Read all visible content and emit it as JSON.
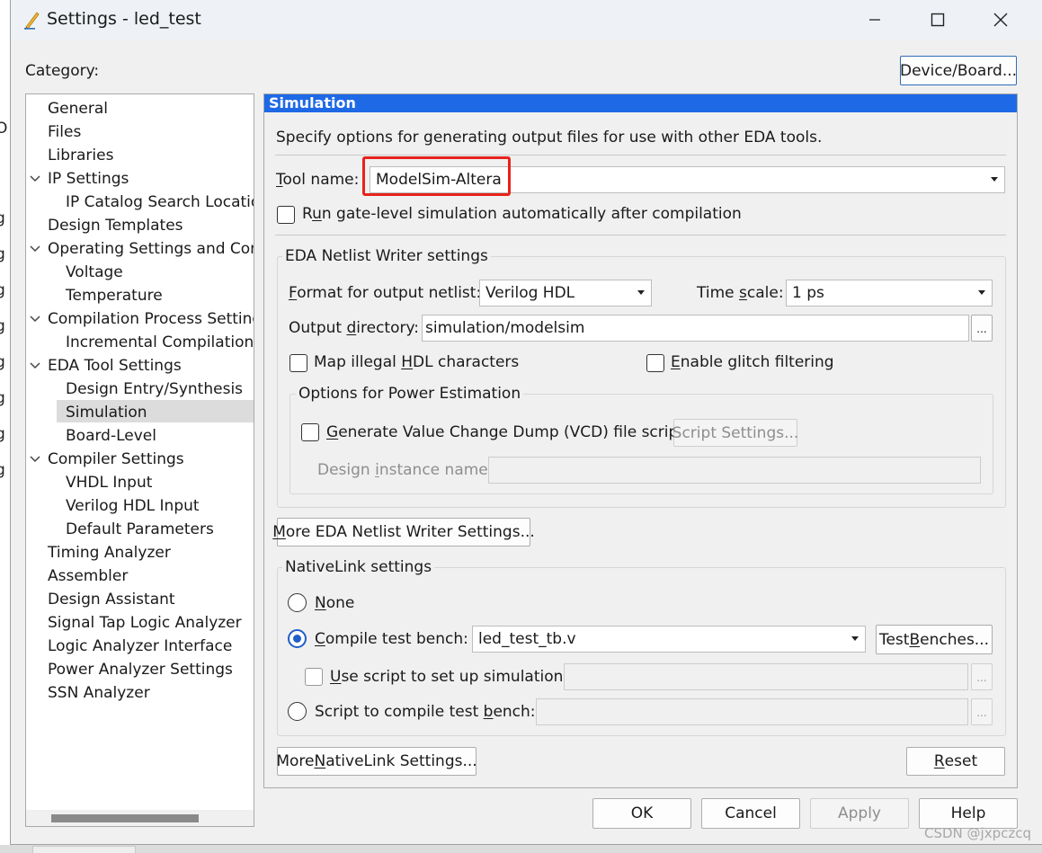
{
  "window": {
    "title": "Settings - led_test",
    "minimize_label": "—",
    "maximize_label": "☐",
    "close_label": "✕"
  },
  "left_strip_glyphs": [
    "O",
    "g",
    "g",
    "g",
    "g",
    "g",
    "g",
    "g",
    "g"
  ],
  "category_label": "Category:",
  "device_board_button": "Device/Board...",
  "tree": {
    "items": [
      {
        "label": "General",
        "level": 0,
        "expanded": null
      },
      {
        "label": "Files",
        "level": 0,
        "expanded": null
      },
      {
        "label": "Libraries",
        "level": 0,
        "expanded": null
      },
      {
        "label": "IP Settings",
        "level": 0,
        "expanded": true
      },
      {
        "label": "IP Catalog Search Locations",
        "level": 1,
        "expanded": null
      },
      {
        "label": "Design Templates",
        "level": 0,
        "expanded": null
      },
      {
        "label": "Operating Settings and Conditions",
        "level": 0,
        "expanded": true
      },
      {
        "label": "Voltage",
        "level": 1,
        "expanded": null
      },
      {
        "label": "Temperature",
        "level": 1,
        "expanded": null
      },
      {
        "label": "Compilation Process Settings",
        "level": 0,
        "expanded": true
      },
      {
        "label": "Incremental Compilation",
        "level": 1,
        "expanded": null
      },
      {
        "label": "EDA Tool Settings",
        "level": 0,
        "expanded": true
      },
      {
        "label": "Design Entry/Synthesis",
        "level": 1,
        "expanded": null
      },
      {
        "label": "Simulation",
        "level": 1,
        "expanded": null,
        "selected": true
      },
      {
        "label": "Board-Level",
        "level": 1,
        "expanded": null
      },
      {
        "label": "Compiler Settings",
        "level": 0,
        "expanded": true
      },
      {
        "label": "VHDL Input",
        "level": 1,
        "expanded": null
      },
      {
        "label": "Verilog HDL Input",
        "level": 1,
        "expanded": null
      },
      {
        "label": "Default Parameters",
        "level": 1,
        "expanded": null
      },
      {
        "label": "Timing Analyzer",
        "level": 0,
        "expanded": null
      },
      {
        "label": "Assembler",
        "level": 0,
        "expanded": null
      },
      {
        "label": "Design Assistant",
        "level": 0,
        "expanded": null
      },
      {
        "label": "Signal Tap Logic Analyzer",
        "level": 0,
        "expanded": null
      },
      {
        "label": "Logic Analyzer Interface",
        "level": 0,
        "expanded": null
      },
      {
        "label": "Power Analyzer Settings",
        "level": 0,
        "expanded": null
      },
      {
        "label": "SSN Analyzer",
        "level": 0,
        "expanded": null
      }
    ]
  },
  "panel": {
    "header": "Simulation",
    "description": "Specify options for generating output files for use with other EDA tools.",
    "tool_name_label": "Tool name:",
    "tool_name_value": "ModelSim-Altera",
    "run_gate_level_label": "Run gate-level simulation automatically after compilation",
    "run_gate_level_checked": false,
    "eda_netlist": {
      "title": "EDA Netlist Writer settings",
      "format_label": "Format for output netlist:",
      "format_value": "Verilog HDL",
      "time_scale_label": "Time scale:",
      "time_scale_value": "1 ps",
      "output_dir_label": "Output directory:",
      "output_dir_value": "simulation/modelsim",
      "browse_label": "...",
      "map_illegal_label": "Map illegal HDL characters",
      "map_illegal_checked": false,
      "glitch_label": "Enable glitch filtering",
      "glitch_checked": false,
      "power": {
        "title": "Options for Power Estimation",
        "vcd_label": "Generate Value Change Dump (VCD) file script",
        "vcd_checked": false,
        "script_settings_button": "Script Settings...",
        "design_instance_label": "Design instance name:",
        "design_instance_value": ""
      }
    },
    "more_eda_button": "More EDA Netlist Writer Settings...",
    "nativelink": {
      "title": "NativeLink settings",
      "none_label": "None",
      "compile_tb_label": "Compile test bench:",
      "compile_tb_value": "led_test_tb.v",
      "test_benches_button": "Test Benches...",
      "use_script_label": "Use script to set up simulation:",
      "use_script_value": "",
      "script_compile_label": "Script to compile test bench:",
      "script_compile_value": "",
      "selected": "compile_tb",
      "browse_label": "..."
    },
    "more_nativelink_button": "More NativeLink Settings...",
    "reset_button": "Reset"
  },
  "footer": {
    "ok": "OK",
    "cancel": "Cancel",
    "apply": "Apply",
    "help": "Help"
  },
  "watermark": "CSDN @jxpczcq"
}
